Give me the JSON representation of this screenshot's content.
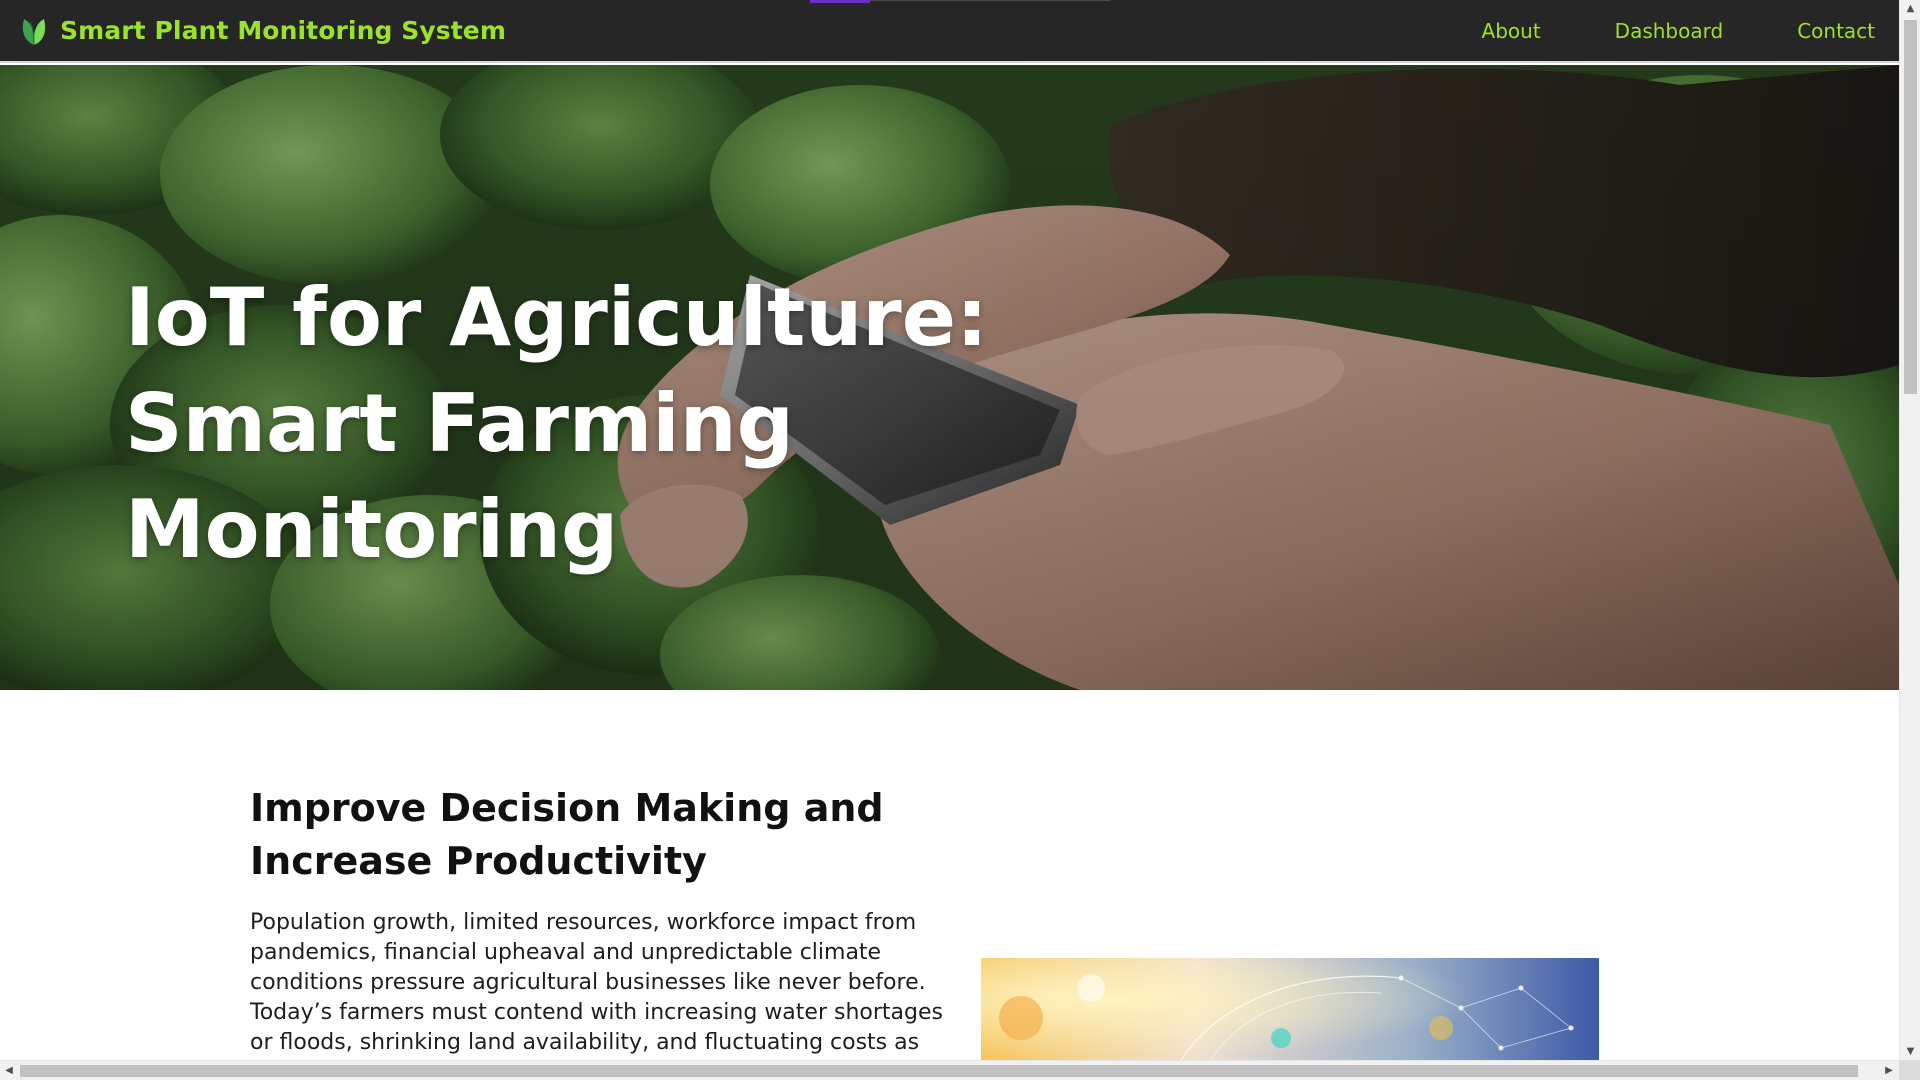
{
  "navbar": {
    "brand_title": "Smart Plant Monitoring System",
    "logo_icon": "leaf-icon",
    "links": [
      "About",
      "Dashboard",
      "Contact"
    ],
    "accent_color": "#9be22b",
    "background_color": "#262626"
  },
  "hero": {
    "title": "IoT for Agriculture: Smart Farming Monitoring",
    "image": "hands-holding-smartphone-over-crop-field"
  },
  "section": {
    "heading": "Improve Decision Making and Increase Productivity",
    "body": "Population growth, limited resources, workforce impact from pandemics, financial upheaval and unpredictable climate conditions pressure agricultural businesses like never before. Today’s farmers must contend with increasing water shortages or floods, shrinking land availability, and fluctuating costs as they work to feed the world.",
    "image": "smart-agriculture-network-illustration"
  },
  "scrollbars": {
    "up_arrow": "▲",
    "down_arrow": "▼",
    "left_arrow": "◀",
    "right_arrow": "▶"
  }
}
